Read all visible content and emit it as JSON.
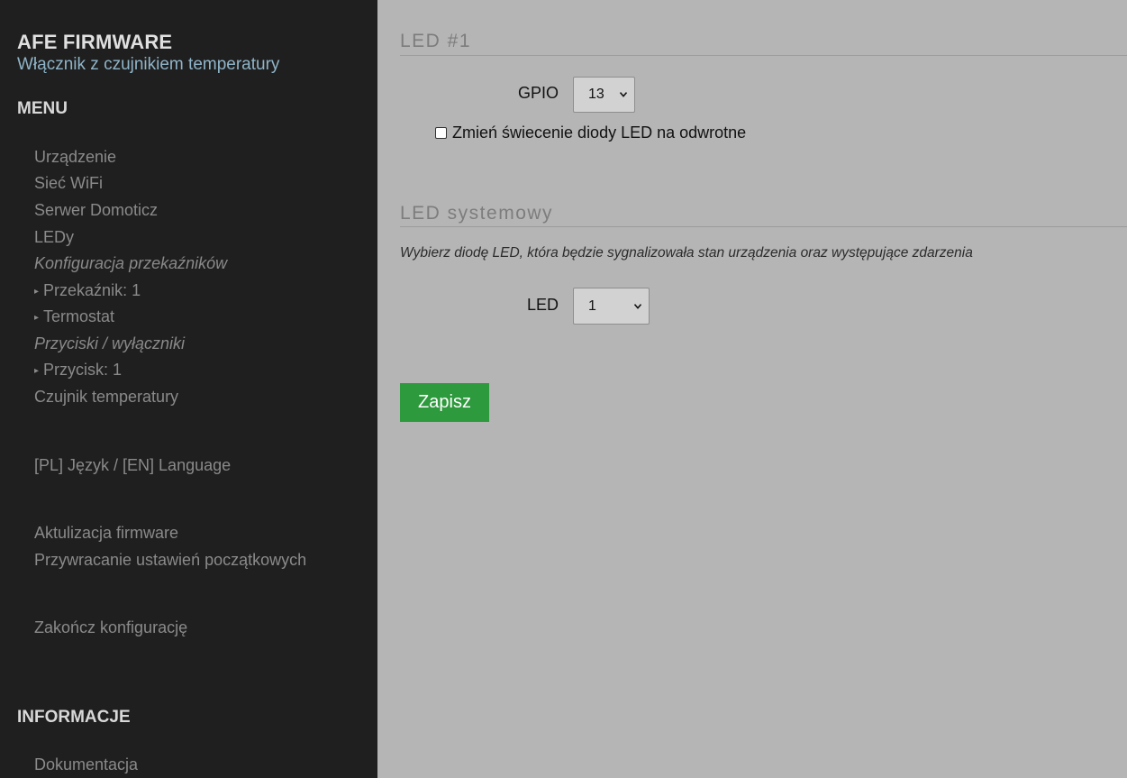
{
  "sidebar": {
    "brand": "AFE FIRMWARE",
    "subtitle": "Włącznik z czujnikiem temperatury",
    "menu_heading": "MENU",
    "items": [
      {
        "label": "Urządzenie",
        "type": "link"
      },
      {
        "label": "Sieć WiFi",
        "type": "link"
      },
      {
        "label": "Serwer Domoticz",
        "type": "link"
      },
      {
        "label": "LEDy",
        "type": "link"
      },
      {
        "label": "Konfiguracja przekaźników",
        "type": "group"
      },
      {
        "label": "Przekaźnik: 1",
        "type": "sub"
      },
      {
        "label": "Termostat",
        "type": "sub"
      },
      {
        "label": "Przyciski / wyłączniki",
        "type": "group"
      },
      {
        "label": "Przycisk: 1",
        "type": "sub"
      },
      {
        "label": "Czujnik temperatury",
        "type": "link"
      },
      {
        "label": "[PL] Język / [EN] Language",
        "type": "link"
      },
      {
        "label": "Aktulizacja firmware",
        "type": "link"
      },
      {
        "label": "Przywracanie ustawień początkowych",
        "type": "link"
      },
      {
        "label": "Zakończ konfigurację",
        "type": "link"
      }
    ],
    "info_heading": "INFORMACJE",
    "info_items": [
      {
        "label": "Dokumentacja",
        "type": "link"
      }
    ]
  },
  "main": {
    "led1": {
      "legend": "LED #1",
      "gpio_label": "GPIO",
      "gpio_value": "13",
      "invert_label": "Zmień świecenie diody LED na odwrotne",
      "invert_checked": false
    },
    "system_led": {
      "legend": "LED systemowy",
      "hint": "Wybierz diodę LED, która będzie sygnalizowała stan urządzenia oraz występujące zdarzenia",
      "led_label": "LED",
      "led_value": "1"
    },
    "save_label": "Zapisz"
  },
  "colors": {
    "sidebar_bg": "#1f1f1f",
    "main_bg": "#b5b5b5",
    "subtitle": "#8fb4c8",
    "nav_text": "#8a8a8a",
    "save_button": "#2d9a3d"
  }
}
